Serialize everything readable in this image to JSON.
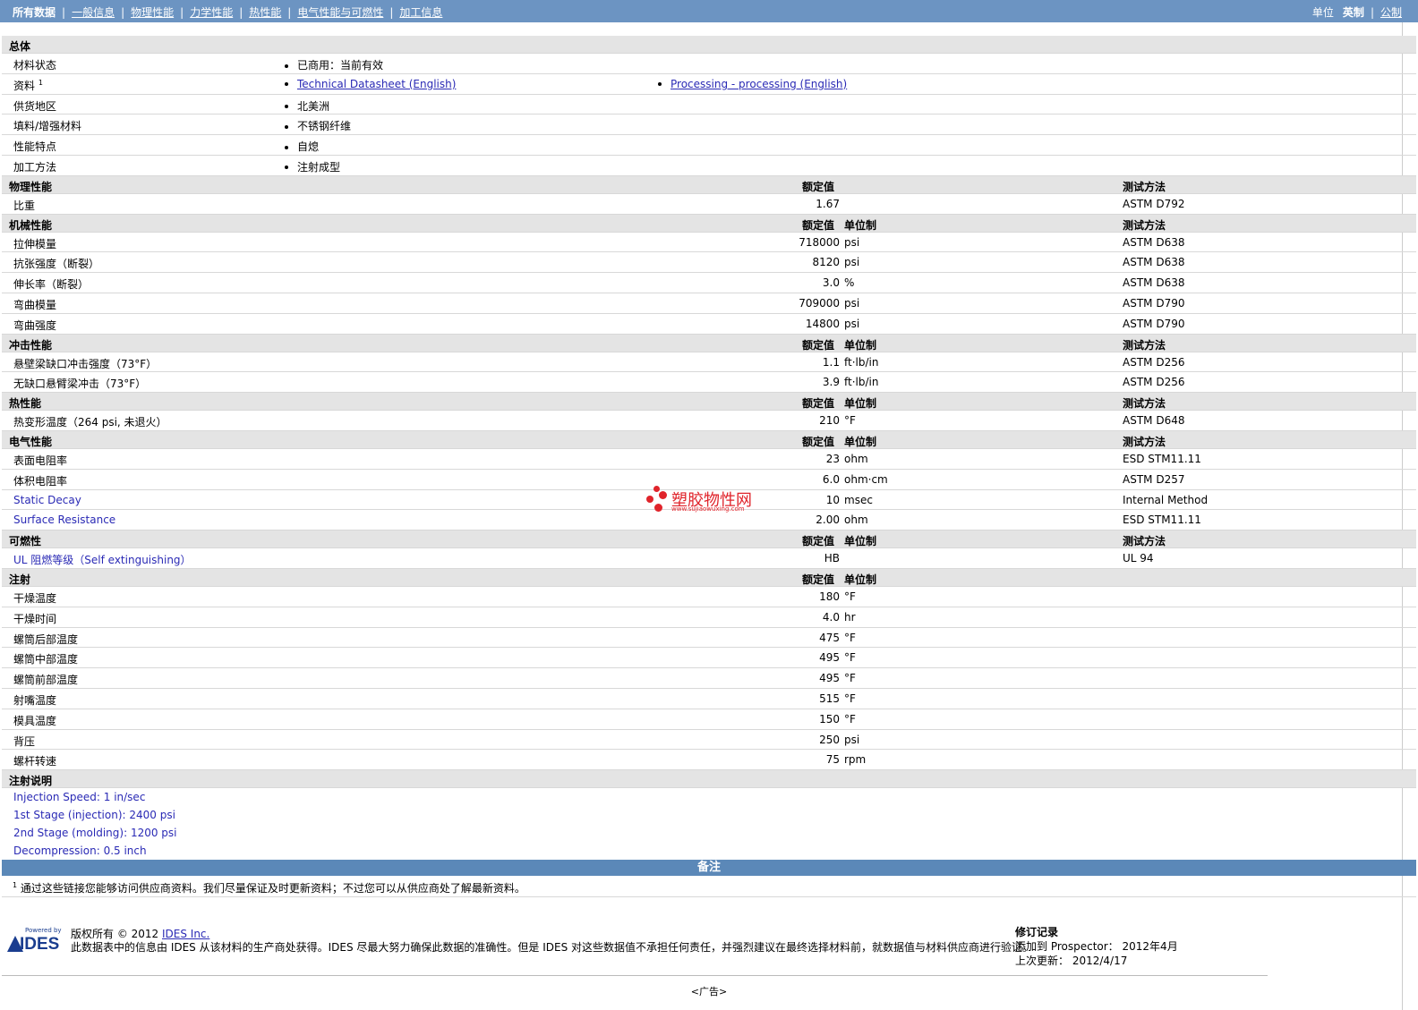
{
  "nav": {
    "items": [
      "所有数据",
      "一般信息",
      "物理性能",
      "力学性能",
      "热性能",
      "电气性能与可燃性",
      "加工信息"
    ],
    "units_label": "单位",
    "unit_imperial": "英制",
    "unit_metric": "公制"
  },
  "general": {
    "title": "总体",
    "rows": [
      {
        "label": "材料状态",
        "values": [
          "已商用：当前有效"
        ]
      },
      {
        "label": "资料",
        "sup": "1",
        "links": [
          "Technical Datasheet (English)",
          "Processing - processing (English)"
        ]
      },
      {
        "label": "供货地区",
        "values": [
          "北美洲"
        ]
      },
      {
        "label": "填料/增强材料",
        "values": [
          "不锈钢纤维"
        ]
      },
      {
        "label": "性能特点",
        "values": [
          "自熄"
        ]
      },
      {
        "label": "加工方法",
        "values": [
          "注射成型"
        ]
      }
    ]
  },
  "headers": {
    "value": "额定值",
    "unit": "单位制",
    "method": "测试方法"
  },
  "sections": [
    {
      "title": "物理性能",
      "show_unit": false,
      "rows": [
        {
          "label": "比重",
          "value": "1.67",
          "unit": "",
          "method": "ASTM D792"
        }
      ]
    },
    {
      "title": "机械性能",
      "show_unit": true,
      "rows": [
        {
          "label": "拉伸模量",
          "value": "718000",
          "unit": "psi",
          "method": "ASTM D638"
        },
        {
          "label": "抗张强度（断裂）",
          "value": "8120",
          "unit": "psi",
          "method": "ASTM D638"
        },
        {
          "label": "伸长率（断裂）",
          "value": "3.0",
          "unit": "%",
          "method": "ASTM D638"
        },
        {
          "label": "弯曲模量",
          "value": "709000",
          "unit": "psi",
          "method": "ASTM D790"
        },
        {
          "label": "弯曲强度",
          "value": "14800",
          "unit": "psi",
          "method": "ASTM D790"
        }
      ]
    },
    {
      "title": "冲击性能",
      "show_unit": true,
      "rows": [
        {
          "label": "悬壁梁缺口冲击强度（73°F）",
          "value": "1.1",
          "unit": "ft·lb/in",
          "method": "ASTM D256"
        },
        {
          "label": "无缺口悬臂梁冲击（73°F）",
          "value": "3.9",
          "unit": "ft·lb/in",
          "method": "ASTM D256"
        }
      ]
    },
    {
      "title": "热性能",
      "show_unit": true,
      "rows": [
        {
          "label": "热变形温度（264 psi, 未退火）",
          "value": "210",
          "unit": "°F",
          "method": "ASTM D648"
        }
      ]
    },
    {
      "title": "电气性能",
      "show_unit": true,
      "rows": [
        {
          "label": "表面电阻率",
          "value": "23",
          "unit": "ohm",
          "method": "ESD STM11.11"
        },
        {
          "label": "体积电阻率",
          "value": "6.0",
          "unit": "ohm·cm",
          "method": "ASTM D257"
        },
        {
          "label": "Static Decay",
          "blue": true,
          "value": "10",
          "unit": "msec",
          "method": "Internal Method"
        },
        {
          "label": "Surface Resistance",
          "blue": true,
          "value": "2.00",
          "unit": "ohm",
          "method": "ESD STM11.11"
        }
      ]
    },
    {
      "title": "可燃性",
      "show_unit": true,
      "rows": [
        {
          "label": "UL 阻燃等级（Self extinguishing）",
          "blue": true,
          "value": "HB",
          "unit": "",
          "method": "UL 94"
        }
      ]
    },
    {
      "title": "注射",
      "show_unit": true,
      "no_method": true,
      "rows": [
        {
          "label": "干燥温度",
          "value": "180",
          "unit": "°F",
          "method": ""
        },
        {
          "label": "干燥时间",
          "value": "4.0",
          "unit": "hr",
          "method": ""
        },
        {
          "label": "螺筒后部温度",
          "value": "475",
          "unit": "°F",
          "method": ""
        },
        {
          "label": "螺筒中部温度",
          "value": "495",
          "unit": "°F",
          "method": ""
        },
        {
          "label": "螺筒前部温度",
          "value": "495",
          "unit": "°F",
          "method": ""
        },
        {
          "label": "射嘴温度",
          "value": "515",
          "unit": "°F",
          "method": ""
        },
        {
          "label": "模具温度",
          "value": "150",
          "unit": "°F",
          "method": ""
        },
        {
          "label": "背压",
          "value": "250",
          "unit": "psi",
          "method": ""
        },
        {
          "label": "螺杆转速",
          "value": "75",
          "unit": "rpm",
          "method": ""
        }
      ]
    }
  ],
  "notes": {
    "title": "注射说明",
    "lines": [
      {
        "label": "Injection Speed:",
        "value": "1 in/sec"
      },
      {
        "label": "1st Stage (injection):",
        "value": "2400 psi"
      },
      {
        "label": "2nd Stage (molding):",
        "value": "1200 psi"
      },
      {
        "label": "Decompression:",
        "value": "0.5 inch"
      }
    ]
  },
  "remarks": {
    "title": "备注",
    "footnote_mark": "1",
    "footnote": "通过这些链接您能够访问供应商资料。我们尽量保证及时更新资料；不过您可以从供应商处了解最新资料。"
  },
  "watermark": {
    "text": "塑胶物性网",
    "url": "www.sujiaowuxing.com"
  },
  "footer": {
    "logo_powered": "Powered by",
    "logo_brand": "IDES",
    "copyright_prefix": "版权所有 © 2012 ",
    "copyright_link": "IDES Inc.",
    "disclaimer": "此数据表中的信息由 IDES 从该材料的生产商处获得。IDES 尽最大努力确保此数据的准确性。但是 IDES 对这些数据值不承担任何责任，并强烈建议在最终选择材料前，就数据值与材料供应商进行验证。",
    "revision_title": "修订记录",
    "added_label": "添加到 Prospector：",
    "added_value": "2012年4月",
    "updated_label": "上次更新：",
    "updated_value": "2012/4/17",
    "ad": "<广告>"
  }
}
